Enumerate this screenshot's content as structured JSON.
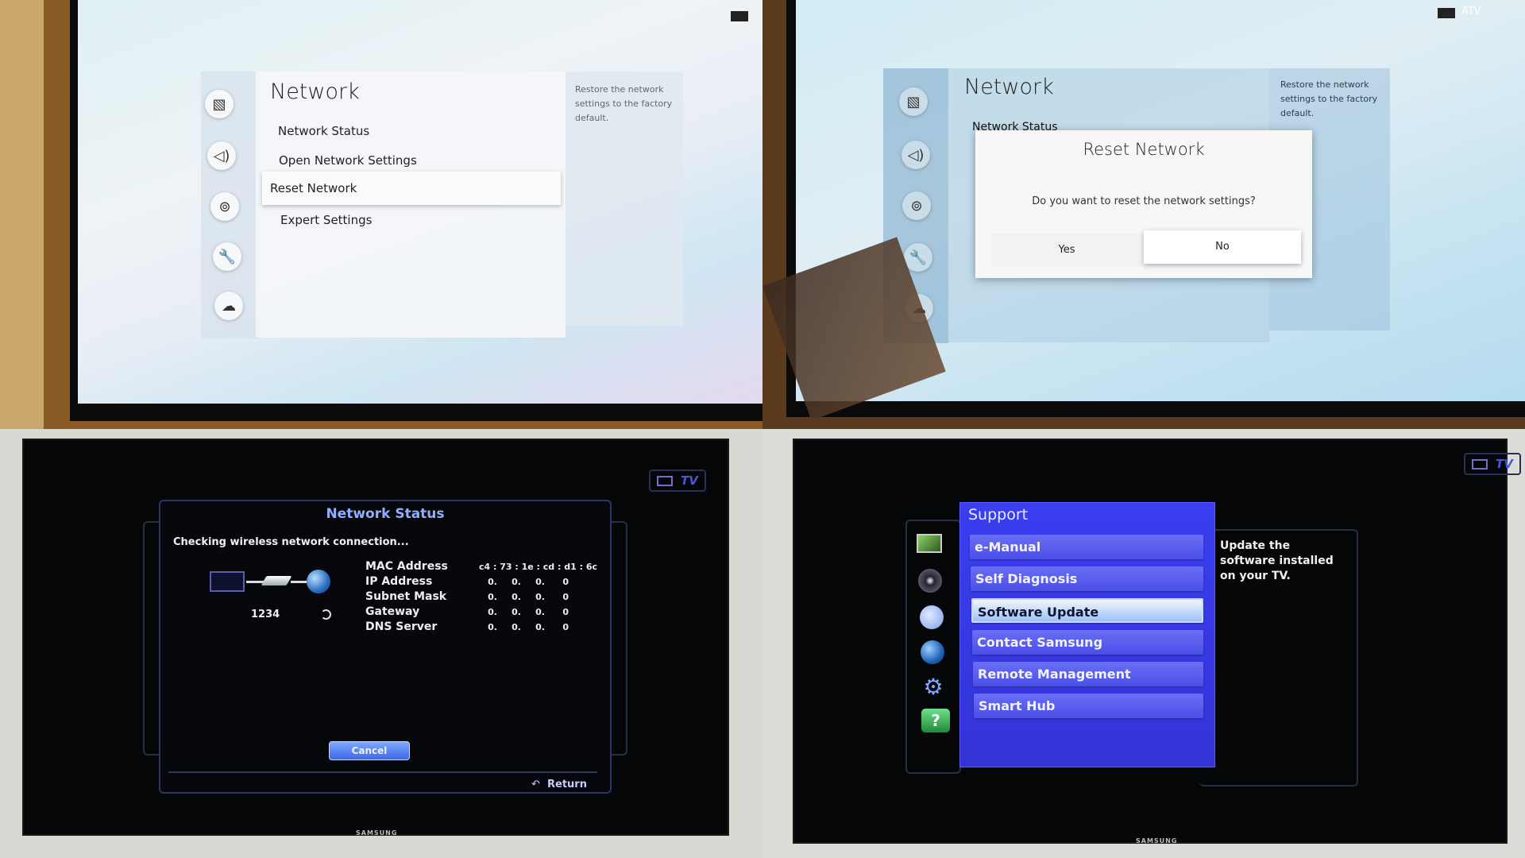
{
  "panels": {
    "top_left": {
      "menu_title": "Network",
      "items": [
        "Network Status",
        "Open Network Settings",
        "Reset Network",
        "Expert Settings"
      ],
      "selected_index": 2,
      "help_text": "Restore the network settings to the factory default.",
      "side_icons": [
        "picture-icon",
        "sound-icon",
        "broadcast-icon",
        "wrench-icon",
        "support-icon"
      ]
    },
    "top_right": {
      "menu_title": "Network",
      "background_item": "Network Status",
      "help_text": "Restore the network settings to the factory default.",
      "source_label": "ATV",
      "dialog": {
        "title": "Reset Network",
        "message": "Do you want to reset the network settings?",
        "yes_label": "Yes",
        "no_label": "No",
        "focused": "No"
      }
    },
    "bottom_left": {
      "source_label": "TV",
      "dialog_title": "Network Status",
      "status_text": "Checking wireless network connection...",
      "network_name": "1234",
      "fields": [
        {
          "label": "MAC Address",
          "value": [
            "c4 : 73 : 1e : cd : d1 : 6c"
          ]
        },
        {
          "label": "IP Address",
          "value": [
            "0.",
            "0.",
            "0.",
            "0"
          ]
        },
        {
          "label": "Subnet Mask",
          "value": [
            "0.",
            "0.",
            "0.",
            "0"
          ]
        },
        {
          "label": "Gateway",
          "value": [
            "0.",
            "0.",
            "0.",
            "0"
          ]
        },
        {
          "label": "DNS Server",
          "value": [
            "0.",
            "0.",
            "0.",
            "0"
          ]
        }
      ],
      "cancel_label": "Cancel",
      "return_label": "Return",
      "brand": "SAMSUNG"
    },
    "bottom_right": {
      "source_label": "TV",
      "menu_title": "Support",
      "items": [
        "e-Manual",
        "Self Diagnosis",
        "Software Update",
        "Contact Samsung",
        "Remote Management",
        "Smart Hub"
      ],
      "selected_index": 2,
      "help_text": "Update the software installed on your TV.",
      "brand": "SAMSUNG"
    }
  },
  "colors": {
    "support_blue": "#3638e6",
    "selected_item": "#cfe0fb",
    "status_title": "#8fb0ff"
  }
}
